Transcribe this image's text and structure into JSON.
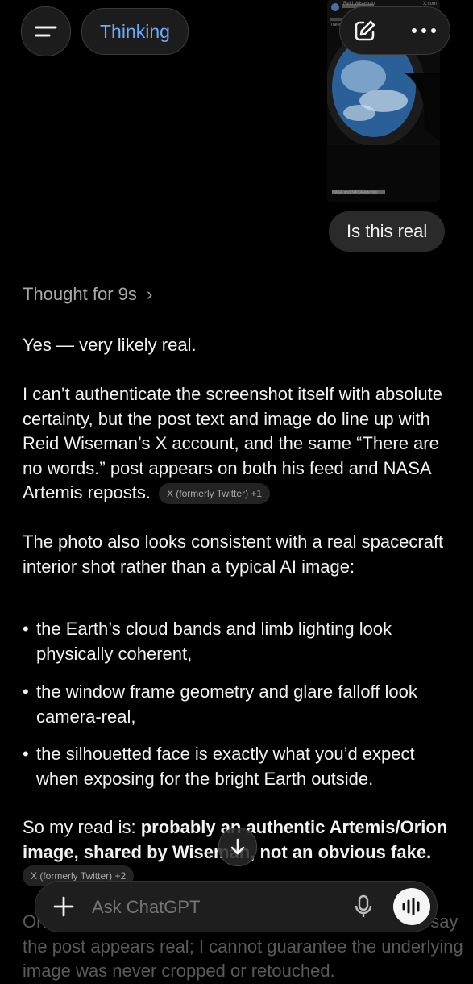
{
  "header": {
    "mode_label": "Thinking",
    "menu_icon": "menu-icon",
    "compose_icon": "compose-icon",
    "more_icon": "more-icon"
  },
  "attachment": {
    "post_author": "Reid Wiseman",
    "post_source": "X.com",
    "post_text": "There are no words.",
    "caption": "NASA and NASA Artemis"
  },
  "user_message": "Is this real",
  "thought_label": "Thought for 9s",
  "response": {
    "p1": "Yes — very likely real.",
    "p2": "I can’t authenticate the screenshot itself with absolute certainty, but the post text and image do line up with Reid Wiseman’s X account, and the same “There are no words.” post appears on both his feed and NASA Artemis reposts.",
    "p2_source": "X (formerly Twitter) +1",
    "p3": "The photo also looks consistent with a real spacecraft interior shot rather than a typical AI image:",
    "bullets": [
      "the Earth’s cloud bands and limb lighting look physically coherent,",
      "the window frame geometry and glare falloff look camera-real,",
      "the silhouetted face is exactly what you’d expect when exposing for the bright Earth outside."
    ],
    "p4_prefix": "So my read is: ",
    "p4_bold": "probably an authentic Artemis/Orion image, shared by Wiseman, not an obvious fake.",
    "p4_source": "X (formerly Twitter) +2",
    "p5_partial": "One caveat: if this is a screenshot of a repost, I can say the post appears real; I cannot guarantee the underlying image was never cropped or retouched."
  },
  "composer": {
    "placeholder": "Ask ChatGPT",
    "plus_icon": "plus-icon",
    "mic_icon": "mic-icon",
    "voice_icon": "voice-mode-icon"
  },
  "colors": {
    "background": "#000000",
    "accent": "#6fa8ff",
    "bubble": "#2a2a2a"
  }
}
